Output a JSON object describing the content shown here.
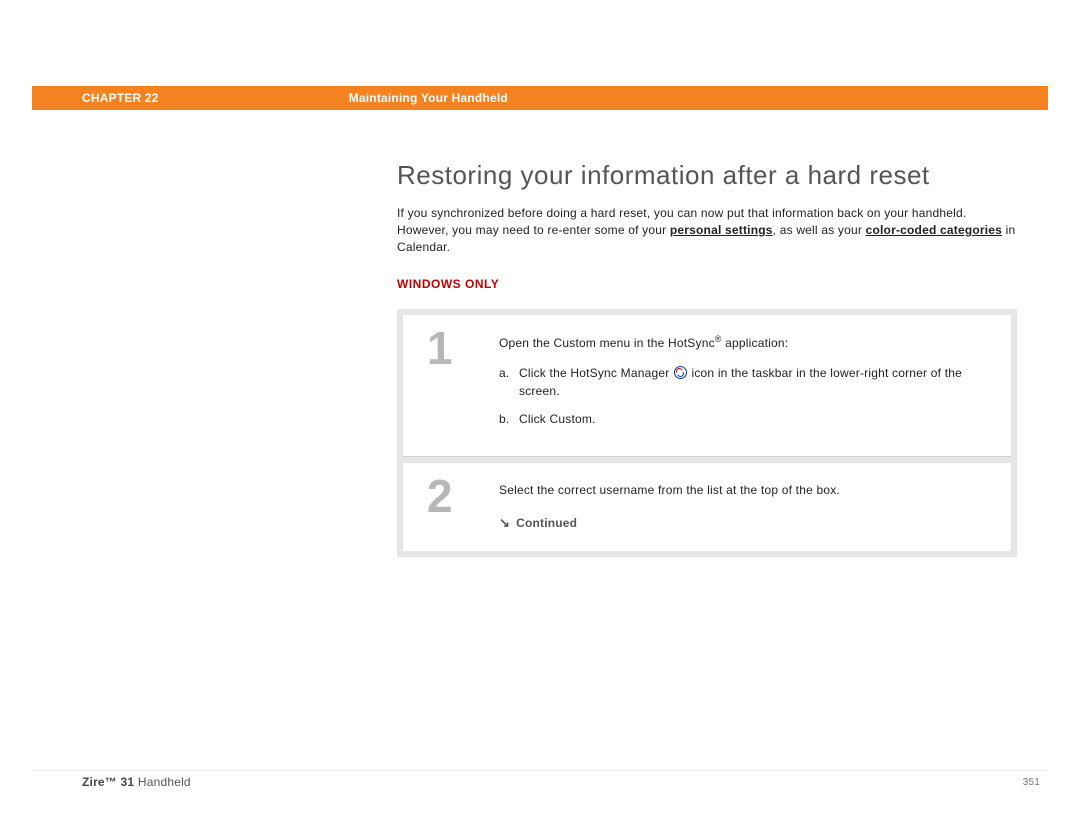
{
  "header": {
    "chapter_label": "CHAPTER 22",
    "chapter_title": "Maintaining Your Handheld"
  },
  "section": {
    "heading": "Restoring your information after a hard reset",
    "intro_before_link1": "If you synchronized before doing a hard reset, you can now put that information back on your handheld. However, you may need to re-enter some of your ",
    "link1": "personal settings",
    "intro_mid": ", as well as your ",
    "link2": "color-coded categories",
    "intro_after_link2": " in Calendar.",
    "platform_label": "WINDOWS ONLY"
  },
  "steps": [
    {
      "num": "1",
      "lead_before": "Open the Custom menu in the HotSync",
      "lead_sup": "®",
      "lead_after": " application:",
      "substeps": [
        {
          "marker": "a.",
          "before": "Click the HotSync Manager ",
          "after": " icon in the taskbar in the lower-right corner of the screen."
        },
        {
          "marker": "b.",
          "before": "Click Custom.",
          "after": ""
        }
      ]
    },
    {
      "num": "2",
      "lead_before": "Select the correct username from the list at the top of the box.",
      "lead_sup": "",
      "lead_after": "",
      "continued": "Continued"
    }
  ],
  "footer": {
    "product_bold": "Zire™ 31",
    "product_rest": " Handheld",
    "page": "351"
  }
}
